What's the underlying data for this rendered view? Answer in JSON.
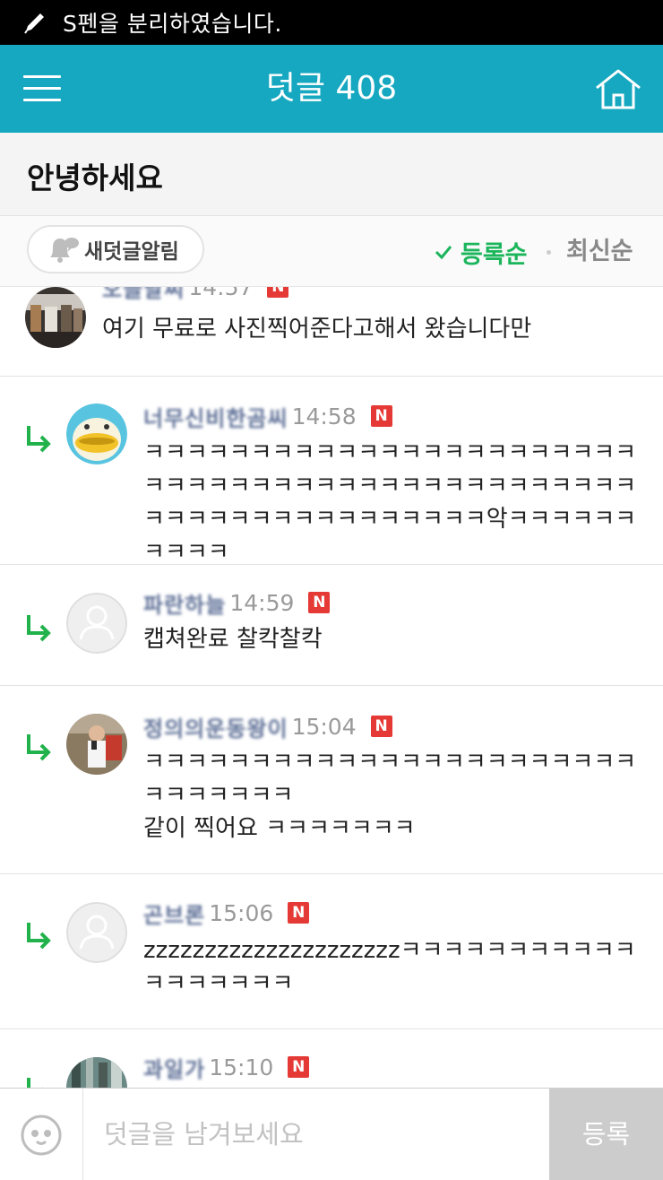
{
  "status_bar": {
    "notice": "S펜을 분리하였습니다.",
    "icon": "pen-icon"
  },
  "app_bar": {
    "title": "덧글 408",
    "menu_icon": "hamburger-menu-icon",
    "home_icon": "home-icon",
    "color": "#16a8c0"
  },
  "post": {
    "title": "안녕하세요"
  },
  "sort_bar": {
    "notify_label": "새덧글알림",
    "sort_registered": "등록순",
    "sort_latest": "최신순",
    "active_sort": "등록순",
    "active_color": "#1bb55b"
  },
  "comments": [
    {
      "nick": "오늘날씨",
      "time": "14:57",
      "badge": "N",
      "text": "여기 무료로 사진찍어준다고해서 왔습니다만",
      "reply": false,
      "avatar": "photo-avatar"
    },
    {
      "nick": "너무신비한곰씨",
      "time": "14:58",
      "badge": "N",
      "text": "ㅋㅋㅋㅋㅋㅋㅋㅋㅋㅋㅋㅋㅋㅋㅋㅋㅋㅋㅋㅋㅋㅋㅋㅋㅋㅋㅋㅋㅋㅋㅋㅋㅋㅋㅋㅋㅋㅋㅋㅋㅋㅋㅋㅋㅋㅋㅋㅋㅋㅋㅋㅋㅋㅋㅋㅋㅋㅋㅋㅋㅋㅋ악ㅋㅋㅋㅋㅋㅋㅋㅋㅋㅋ",
      "reply": true,
      "avatar": "duck-avatar"
    },
    {
      "nick": "파란하늘",
      "time": "14:59",
      "badge": "N",
      "text": "캡쳐완료 찰칵찰칵",
      "reply": true,
      "avatar": "default-avatar"
    },
    {
      "nick": "정의의운동왕이",
      "time": "15:04",
      "badge": "N",
      "text": "ㅋㅋㅋㅋㅋㅋㅋㅋㅋㅋㅋㅋㅋㅋㅋㅋㅋㅋㅋㅋㅋㅋㅋㅋㅋㅋㅋㅋㅋㅋ\n같이 찍어요 ㅋㅋㅋㅋㅋㅋㅋ",
      "reply": true,
      "avatar": "photo-avatar"
    },
    {
      "nick": "곤브론",
      "time": "15:06",
      "badge": "N",
      "text": "zzzzzzzzzzzzzzzzzzzzzㅋㅋㅋㅋㅋㅋㅋㅋㅋㅋㅋㅋㅋㅋㅋㅋㅋㅋ",
      "reply": true,
      "avatar": "default-avatar"
    },
    {
      "nick": "과일가",
      "time": "15:10",
      "badge": "N",
      "text": "",
      "reply": true,
      "avatar": "photo-avatar"
    }
  ],
  "composer": {
    "placeholder": "덧글을 남겨보세요",
    "submit_label": "등록",
    "emoji_icon": "emoticon-icon"
  }
}
